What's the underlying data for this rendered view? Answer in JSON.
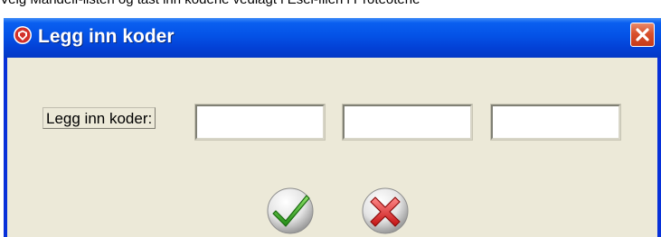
{
  "background_text": "Velg Mandelf-listen og tast inn kodene vedlagt i Esel-filen i Proteotene",
  "window": {
    "title": "Legg inn koder",
    "close_icon": "close-icon",
    "app_icon": "shield-icon"
  },
  "form": {
    "label": "Legg inn koder:",
    "codes": [
      {
        "value": "",
        "placeholder": ""
      },
      {
        "value": "",
        "placeholder": ""
      },
      {
        "value": "",
        "placeholder": ""
      }
    ]
  },
  "actions": {
    "ok_icon": "checkmark-icon",
    "cancel_icon": "x-icon"
  },
  "colors": {
    "titlebar": "#0452e6",
    "window_body": "#ece9d8",
    "close_button": "#d9512c",
    "ok_green": "#2e9d1e",
    "cancel_red": "#d81e1e"
  }
}
